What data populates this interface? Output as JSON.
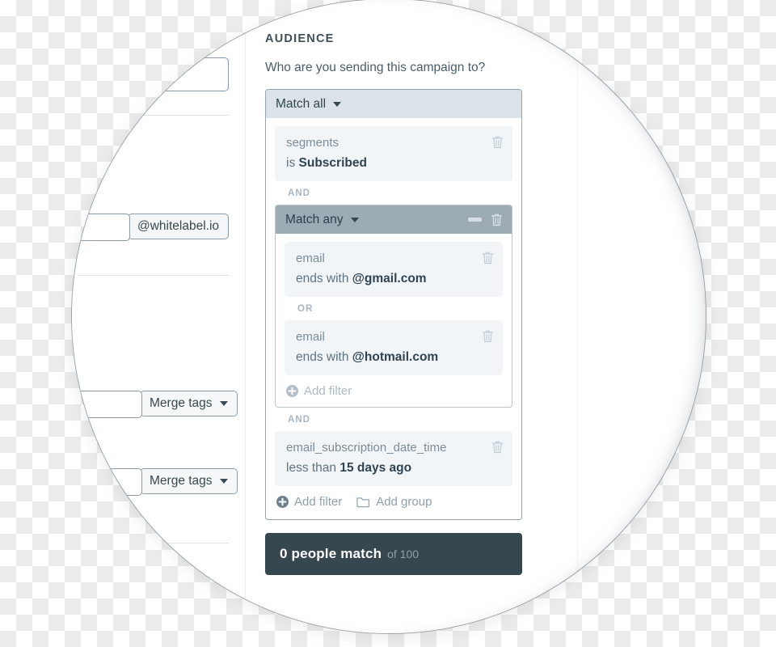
{
  "panel": {
    "section_title": "AUDIENCE",
    "section_subtitle": "Who are you sending this campaign to?"
  },
  "group_outer": {
    "match_label": "Match all",
    "delete_icon": "trash-icon",
    "caret_icon": "chevron-down-icon"
  },
  "filters": {
    "segments": {
      "field": "segments",
      "operator": "is",
      "value": "Subscribed"
    },
    "gmail": {
      "field": "email",
      "operator": "ends with",
      "value": "@gmail.com"
    },
    "hotmail": {
      "field": "email",
      "operator": "ends with",
      "value": "@hotmail.com"
    },
    "subscription_date": {
      "field": "email_subscription_date_time",
      "operator": "less than",
      "value": "15 days ago"
    }
  },
  "connectors": {
    "and_1": "AND",
    "or_1": "OR",
    "and_2": "AND"
  },
  "group_nested": {
    "match_label": "Match any",
    "minimize_icon": "minimize-icon",
    "delete_icon": "trash-icon",
    "caret_icon": "chevron-down-icon"
  },
  "actions": {
    "nested_add_filter": "Add filter",
    "add_filter": "Add filter",
    "add_group": "Add group",
    "plus_icon": "circle-plus-icon",
    "folder_icon": "folder-icon"
  },
  "result_bar": {
    "count_text": "0 people match",
    "total_text": "of 100"
  },
  "left_column": {
    "email_domain_chip": "@whitelabel.io",
    "merge_tags_1": "Merge tags",
    "merge_tags_2": "Merge tags",
    "caret_icon": "chevron-down-icon"
  },
  "colors": {
    "accent_dark": "#37474f",
    "match_all_bg": "#dbe3e9",
    "match_any_bg": "#9dabb4",
    "filter_bg": "#f1f5f8",
    "connector_text": "#a7b6c2"
  }
}
